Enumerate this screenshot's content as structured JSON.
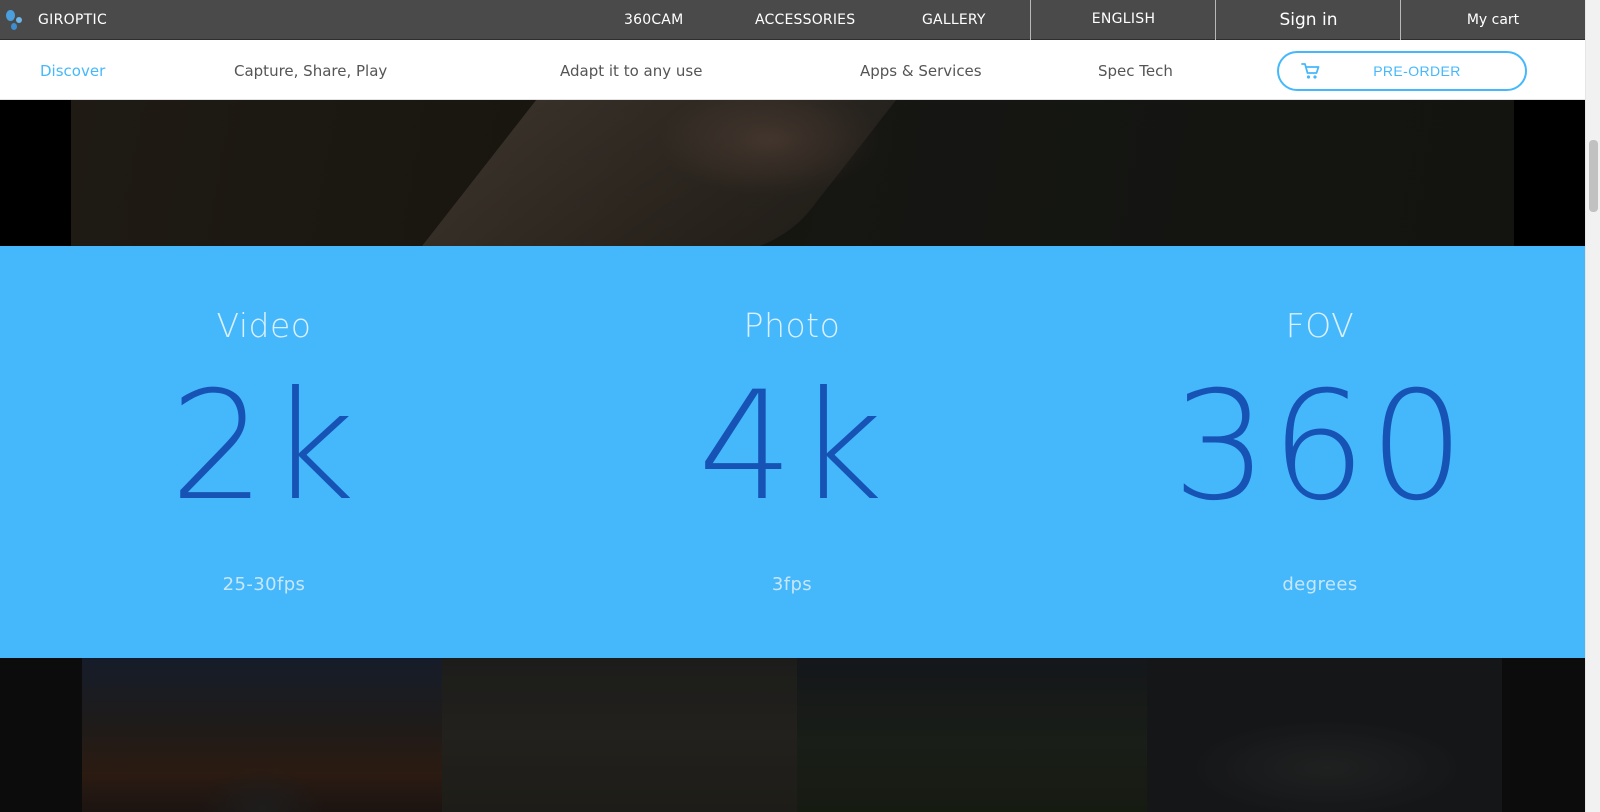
{
  "topbar": {
    "brand": "GIROPTIC",
    "nav": [
      "360CAM",
      "ACCESSORIES",
      "GALLERY"
    ],
    "language": "ENGLISH",
    "signin": "Sign in",
    "cart": "My cart"
  },
  "subnav": {
    "items": [
      "Discover",
      "Capture, Share, Play",
      "Adapt it to any use",
      "Apps & Services",
      "Spec Tech"
    ],
    "active": "Discover",
    "preorder": "PRE-ORDER"
  },
  "specs": [
    {
      "title": "Video",
      "value": "2k",
      "unit": "25-30fps"
    },
    {
      "title": "Photo",
      "value": "4k",
      "unit": "3fps"
    },
    {
      "title": "FOV",
      "value": "360",
      "unit": "degrees"
    }
  ],
  "colors": {
    "accent": "#45b8fc",
    "spec_band": "#45b8fc",
    "spec_value": "#1653b5",
    "topbar": "#4a4a4a"
  },
  "icons": {
    "brand": "giroptic-logo-icon",
    "preorder": "shopping-cart-icon"
  }
}
